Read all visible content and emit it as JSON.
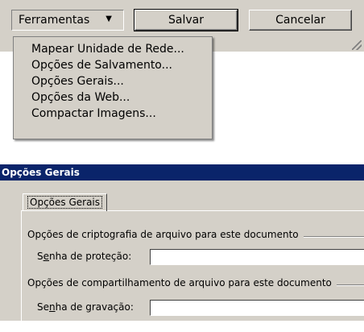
{
  "toolbar": {
    "tools_label": "Ferramentas",
    "save_label": "Salvar",
    "cancel_label": "Cancelar"
  },
  "menu": {
    "items": [
      {
        "label": "Mapear Unidade de Rede..."
      },
      {
        "label": "Opções de Salvamento..."
      },
      {
        "label": "Opções Gerais..."
      },
      {
        "label": "Opções da Web..."
      },
      {
        "label": "Compactar Imagens..."
      }
    ]
  },
  "dialog": {
    "title": "Opções Gerais",
    "tab_label": "Opções Gerais",
    "encryption_group": "Opções de criptografia de arquivo para este documento",
    "open_password": {
      "pre": "S",
      "accel": "e",
      "post": "nha de proteção:",
      "value": ""
    },
    "sharing_group": "Opções de compartilhamento de arquivo para este documento",
    "modify_password": {
      "pre": "Se",
      "accel": "n",
      "post": "ha de gravação:",
      "value": ""
    }
  }
}
